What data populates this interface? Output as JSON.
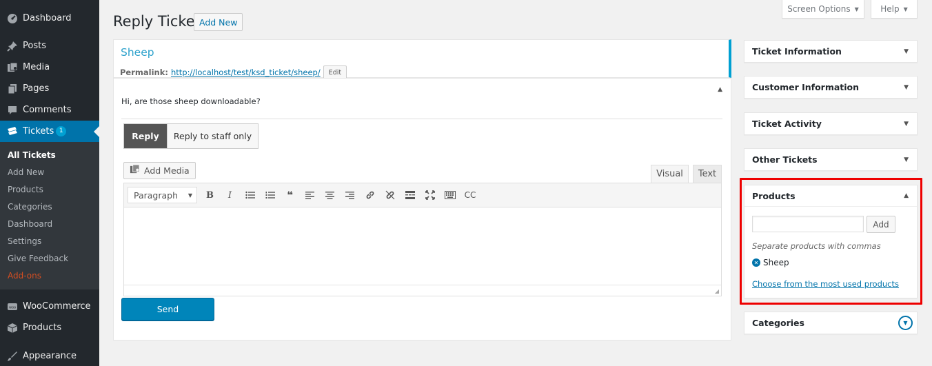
{
  "top_buttons": {
    "screen_options": "Screen Options",
    "help": "Help"
  },
  "page": {
    "title": "Reply Ticket",
    "add_new": "Add New"
  },
  "menu": {
    "items_top": [
      {
        "label": "Dashboard",
        "icon": "dashboard-icon"
      },
      {
        "label": "Posts",
        "icon": "pin-icon"
      },
      {
        "label": "Media",
        "icon": "media-icon"
      },
      {
        "label": "Pages",
        "icon": "pages-icon"
      },
      {
        "label": "Comments",
        "icon": "comments-icon"
      }
    ],
    "current": {
      "label": "Tickets",
      "badge": "1",
      "icon": "tickets-icon"
    },
    "submenu": [
      "All Tickets",
      "Add New",
      "Products",
      "Categories",
      "Dashboard",
      "Settings",
      "Give Feedback",
      "Add-ons"
    ],
    "items_bottom": [
      {
        "label": "WooCommerce",
        "icon": "woocommerce-icon"
      },
      {
        "label": "Products",
        "icon": "products-icon"
      },
      {
        "label": "Appearance",
        "icon": "appearance-icon"
      }
    ]
  },
  "ticket": {
    "title": "Sheep",
    "permalink_label": "Permalink:",
    "permalink_url": "http://localhost/test/ksd_ticket/sheep/",
    "edit": "Edit",
    "message": "Hi, are those sheep downloadable?"
  },
  "reply": {
    "tab_reply": "Reply",
    "tab_staff": "Reply to staff only",
    "add_media": "Add Media",
    "tab_visual": "Visual",
    "tab_text": "Text",
    "format": "Paragraph",
    "cc": "CC",
    "send": "Send"
  },
  "sidebar_boxes": {
    "ticket_info": "Ticket Information",
    "customer_info": "Customer Information",
    "ticket_activity": "Ticket Activity",
    "other_tickets": "Other Tickets",
    "products": {
      "title": "Products",
      "add": "Add",
      "hint": "Separate products with commas",
      "tag": "Sheep",
      "link": "Choose from the most used products"
    },
    "categories": "Categories"
  },
  "colors": {
    "menu_bg": "#23282d",
    "accent": "#0073aa",
    "primary_button": "#0085ba",
    "highlight": "#ee0000",
    "addons": "#d54e21"
  }
}
